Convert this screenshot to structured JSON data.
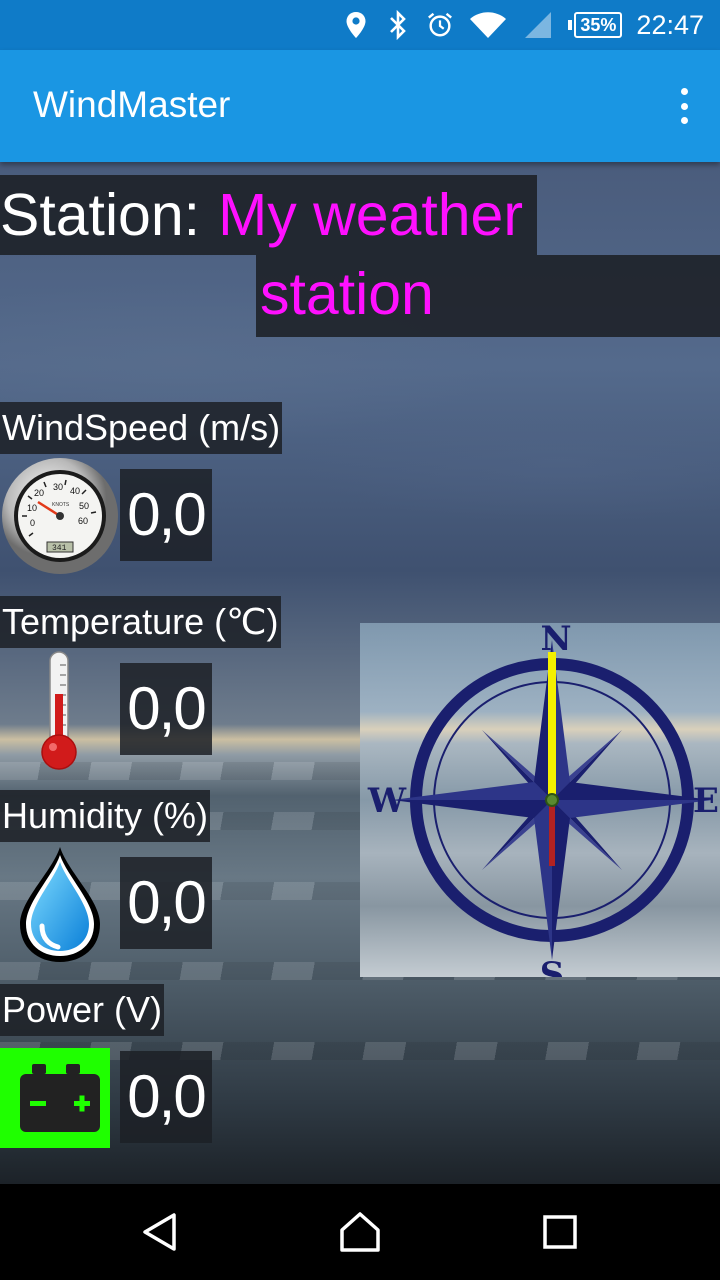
{
  "status_bar": {
    "battery": "35%",
    "time": "22:47",
    "icons": [
      "location-icon",
      "bluetooth-icon",
      "alarm-icon",
      "wifi-icon",
      "signal-icon",
      "battery-icon"
    ]
  },
  "app_bar": {
    "title": "WindMaster",
    "menu_icon": "overflow-menu-icon"
  },
  "station": {
    "label": "Station:",
    "name_line1": "My weather",
    "name_line2": "station"
  },
  "readings": {
    "wind": {
      "label": "WindSpeed (m/s)",
      "value": "0,0",
      "icon": "speedometer-icon"
    },
    "temperature": {
      "label": "Temperature (℃)",
      "value": "0,0",
      "icon": "thermometer-icon"
    },
    "humidity": {
      "label": "Humidity (%)",
      "value": "0,0",
      "icon": "water-drop-icon"
    },
    "power": {
      "label": "Power (V)",
      "value": "0,0",
      "icon": "battery-icon"
    }
  },
  "compass": {
    "north": "N",
    "south": "S",
    "east": "E",
    "west": "W",
    "needle_direction_deg": 0,
    "colors": {
      "rose": "#1a1f6e",
      "needle_north": "#f5f000",
      "needle_south": "#b22222"
    }
  },
  "gauge": {
    "ticks": [
      "0",
      "10",
      "20",
      "30",
      "40",
      "50",
      "60"
    ],
    "unit": "KNOTS",
    "odometer": "341"
  },
  "nav": {
    "back": "back-icon",
    "home": "home-icon",
    "recents": "recents-icon"
  },
  "colors": {
    "status_bar": "#0f7bc8",
    "app_bar": "#1a96e3",
    "station_name": "#ff10ff",
    "battery_indicator_bg": "#1fff00"
  }
}
